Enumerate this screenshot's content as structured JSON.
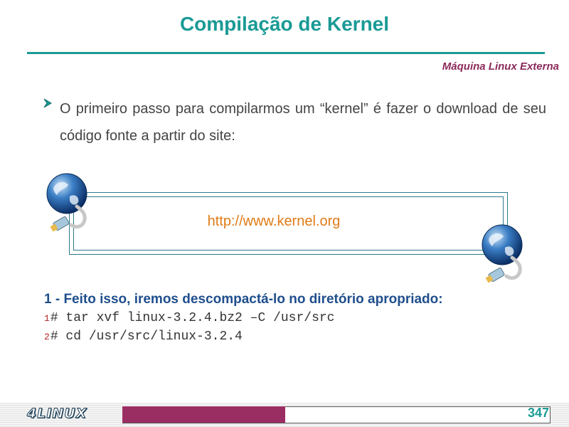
{
  "slide": {
    "title": "Compilação de Kernel",
    "subtitle": "Máquina Linux Externa",
    "bullet": "O primeiro passo para compilarmos um “kernel” é fazer o download de seu código fonte a partir do site:",
    "link": "http://www.kernel.org",
    "step_heading": "1 - Feito isso, iremos descompactá-lo no diretório apropriado:",
    "code_lines": [
      {
        "number": "1",
        "text": "# tar xvf linux-3.2.4.bz2 –C /usr/src"
      },
      {
        "number": "2",
        "text": "# cd /usr/src/linux-3.2.4"
      }
    ]
  },
  "footer": {
    "logo": "4LINUX",
    "page_number": "347"
  },
  "colors": {
    "title": "#1a9a95",
    "subtitle": "#8b2b5a",
    "link": "#e07b16",
    "heading": "#1f4e8c",
    "footer_bar": "#9a2e63"
  },
  "icons": {
    "bullet": "arrow-bullet-icon",
    "globe": "globe-network-cable-icon"
  }
}
